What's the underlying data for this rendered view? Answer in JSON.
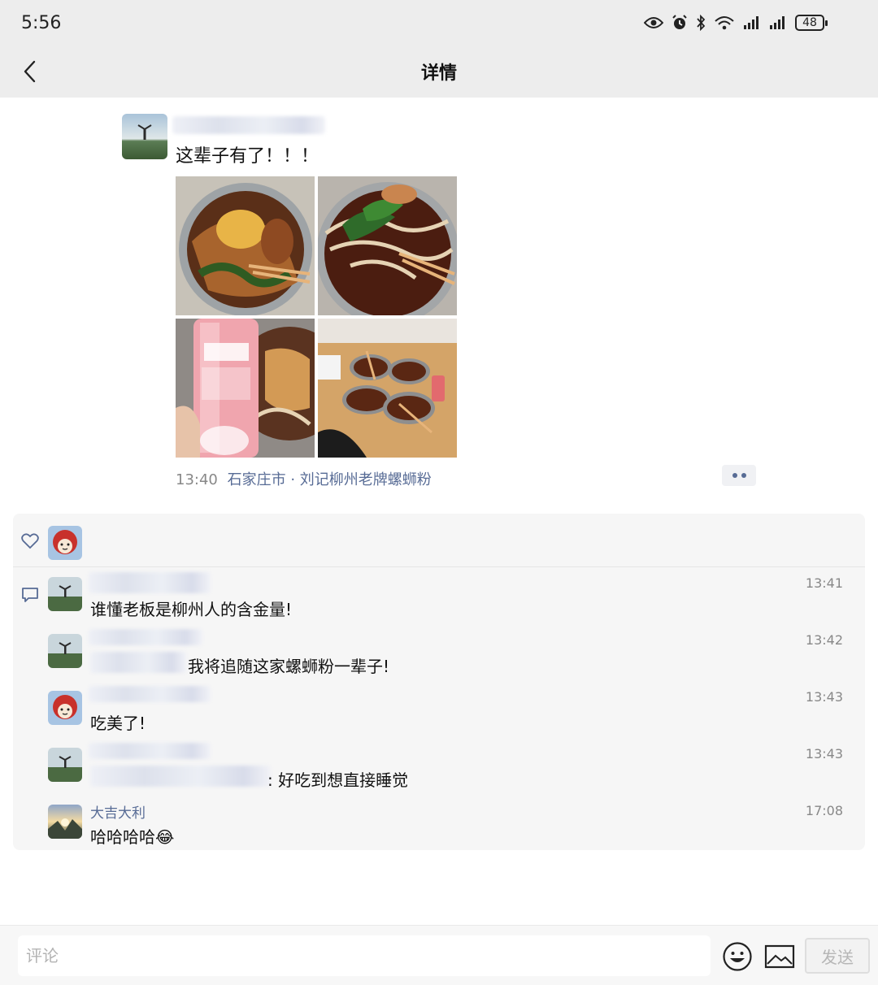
{
  "status_bar": {
    "time": "5:56",
    "battery": "48",
    "icons": [
      "eye-icon",
      "alarm-icon",
      "bluetooth-icon",
      "wifi-icon",
      "signal-icon",
      "signal-icon",
      "battery-icon"
    ]
  },
  "header": {
    "title": "详情",
    "back_icon": "chevron-left-icon"
  },
  "post": {
    "text": "这辈子有了！！！",
    "photos": [
      "noodle-bowl-photo",
      "noodle-greens-photo",
      "pink-drink-can-photo",
      "table-bowls-photo"
    ],
    "time": "13:40",
    "location": "石家庄市 · 刘记柳州老牌螺蛳粉"
  },
  "comments": [
    {
      "name": "",
      "text": "谁懂老板是柳州人的含金量!",
      "time": "13:41"
    },
    {
      "name": "",
      "text": "我将追随这家螺蛳粉一辈子!",
      "time": "13:42"
    },
    {
      "name": "",
      "text": "吃美了!",
      "time": "13:43"
    },
    {
      "name": "",
      "text": ": 好吃到想直接睡觉",
      "time": "13:43"
    },
    {
      "name": "大吉大利",
      "text": "哈哈哈哈😂",
      "time": "17:08"
    }
  ],
  "bottom_bar": {
    "placeholder": "评论",
    "send_label": "发送"
  },
  "colors": {
    "header_bg": "#ededed",
    "link": "#576b95",
    "panel_bg": "#f6f6f6"
  }
}
